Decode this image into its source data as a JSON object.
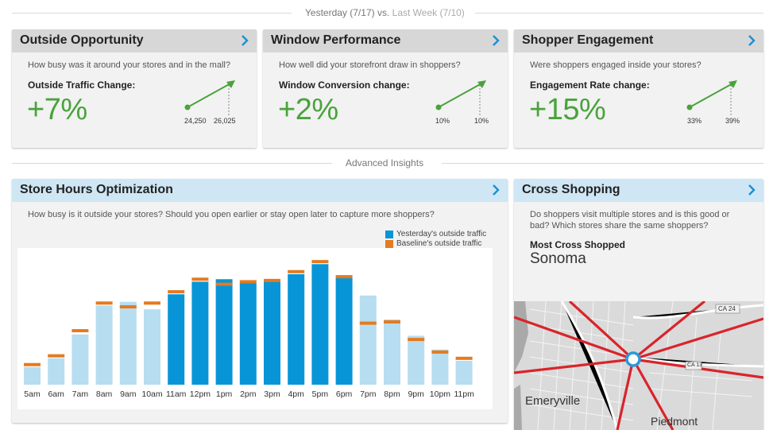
{
  "comparison": {
    "current": "Yesterday (7/17)",
    "vs": "vs.",
    "previous": "Last Week (7/10)"
  },
  "advanced_label": "Advanced Insights",
  "colors": {
    "positive": "#49a33b",
    "yesterday_bar": "#0895d7",
    "yesterday_bar_light": "#b7ddf0",
    "baseline": "#e57a1f",
    "chevron": "#1b8fd3",
    "route": "#d9242b"
  },
  "cards": {
    "outside": {
      "title": "Outside Opportunity",
      "question": "How busy was it around your stores and in the mall?",
      "metric_label": "Outside Traffic Change:",
      "value": "+7%",
      "from": "24,250",
      "to": "26,025"
    },
    "window": {
      "title": "Window Performance",
      "question": "How well did your storefront draw in shoppers?",
      "metric_label": "Window Conversion change:",
      "value": "+2%",
      "from": "10%",
      "to": "10%"
    },
    "engagement": {
      "title": "Shopper Engagement",
      "question": "Were shoppers engaged inside your stores?",
      "metric_label": "Engagement Rate change:",
      "value": "+15%",
      "from": "33%",
      "to": "39%"
    }
  },
  "store_hours": {
    "title": "Store Hours Optimization",
    "question": "How busy is it outside your stores? Should you open earlier or stay open later to capture more shoppers?",
    "legend": [
      "Yesterday's outside traffic",
      "Baseline's outside traffic"
    ]
  },
  "chart_data": {
    "type": "bar",
    "categories": [
      "5am",
      "6am",
      "7am",
      "8am",
      "9am",
      "10am",
      "11am",
      "12pm",
      "1pm",
      "2pm",
      "3pm",
      "4pm",
      "5pm",
      "6pm",
      "7pm",
      "8pm",
      "9pm",
      "10pm",
      "11pm"
    ],
    "open_hours": [
      "11am",
      "12pm",
      "1pm",
      "2pm",
      "3pm",
      "4pm",
      "5pm",
      "6pm"
    ],
    "series": [
      {
        "name": "Yesterday's outside traffic",
        "values": [
          14,
          21,
          40,
          63,
          66,
          60,
          72,
          82,
          84,
          81,
          82,
          88,
          96,
          85,
          71,
          52,
          39,
          28,
          19
        ]
      },
      {
        "name": "Baseline's outside traffic",
        "values": [
          16,
          23,
          43,
          65,
          62,
          65,
          74,
          84,
          80,
          82,
          83,
          90,
          98,
          86,
          49,
          50,
          36,
          26,
          21
        ]
      }
    ],
    "ylim": [
      0,
      100
    ]
  },
  "cross": {
    "title": "Cross Shopping",
    "question": "Do shoppers visit multiple stores and is this good or bad? Which stores share the same shoppers?",
    "label": "Most Cross Shopped",
    "value": "Sonoma"
  },
  "map": {
    "places": [
      "Emeryville",
      "Piedmont"
    ],
    "roads": [
      "CA 24",
      "CA 13"
    ]
  },
  "icons": {
    "chevron": "chevron-right-icon",
    "trend": "trend-up-arrow-icon",
    "store_pin": "store-location-pin-icon"
  }
}
